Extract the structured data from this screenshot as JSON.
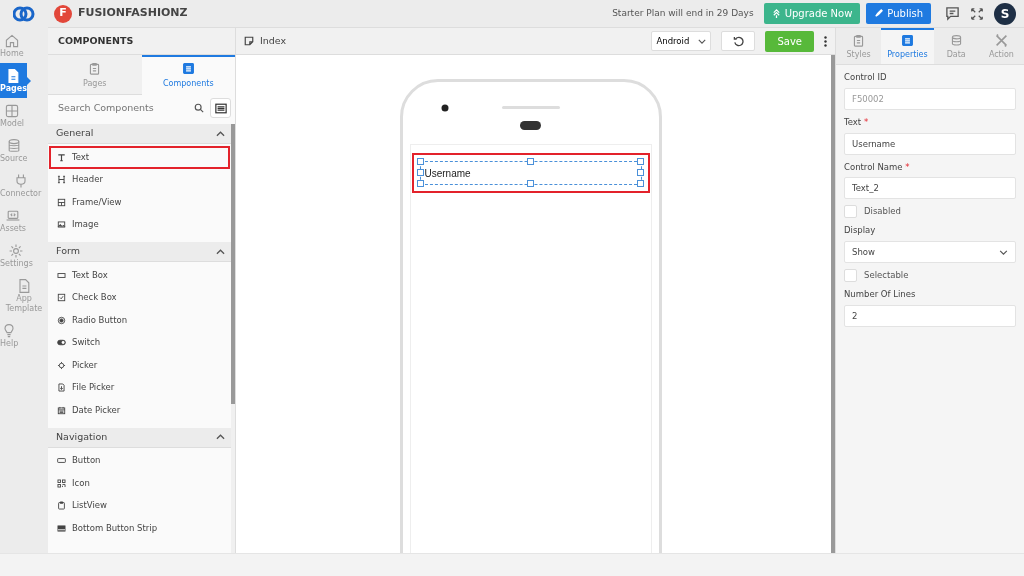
{
  "rail": {
    "items": [
      {
        "label": "Home",
        "selected": false
      },
      {
        "label": "Pages",
        "selected": true
      },
      {
        "label": "Model",
        "selected": false
      },
      {
        "label": "Source",
        "selected": false
      },
      {
        "label": "Connector",
        "selected": false
      },
      {
        "label": "Assets",
        "selected": false
      },
      {
        "label": "Settings",
        "selected": false
      },
      {
        "label": "App Template",
        "selected": false
      },
      {
        "label": "Help",
        "selected": false
      }
    ]
  },
  "header": {
    "logo_letter": "F",
    "app_name": "FUSIONFASHIONZ",
    "plan_notice": "Starter Plan will end in 29 Days",
    "upgrade": "Upgrade Now",
    "publish": "Publish",
    "avatar": "S"
  },
  "components_panel": {
    "title": "COMPONENTS",
    "tabs": [
      {
        "label": "Pages",
        "selected": false
      },
      {
        "label": "Components",
        "selected": true
      }
    ],
    "search": {
      "placeholder": "Search Components"
    },
    "groups": [
      {
        "title": "General",
        "expanded": true,
        "items": [
          {
            "label": "Text",
            "selected": true
          },
          {
            "label": "Header",
            "selected": false
          },
          {
            "label": "Frame/View",
            "selected": false
          },
          {
            "label": "Image",
            "selected": false
          }
        ]
      },
      {
        "title": "Form",
        "expanded": true,
        "items": [
          {
            "label": "Text Box",
            "selected": false
          },
          {
            "label": "Check Box",
            "selected": false
          },
          {
            "label": "Radio Button",
            "selected": false
          },
          {
            "label": "Switch",
            "selected": false
          },
          {
            "label": "Picker",
            "selected": false
          },
          {
            "label": "File Picker",
            "selected": false
          },
          {
            "label": "Date Picker",
            "selected": false
          }
        ]
      },
      {
        "title": "Navigation",
        "expanded": true,
        "items": [
          {
            "label": "Button",
            "selected": false
          },
          {
            "label": "Icon",
            "selected": false
          },
          {
            "label": "ListView",
            "selected": false
          },
          {
            "label": "Bottom Button Strip",
            "selected": false
          }
        ]
      }
    ]
  },
  "canvas": {
    "page_name": "Index",
    "device": "Android",
    "save": "Save",
    "elements": [
      {
        "text": "Username",
        "selected": true
      }
    ]
  },
  "properties_panel": {
    "tabs": [
      {
        "label": "Styles",
        "selected": false
      },
      {
        "label": "Properties",
        "selected": true
      },
      {
        "label": "Data",
        "selected": false
      },
      {
        "label": "Action",
        "selected": false
      }
    ],
    "fields": [
      {
        "kind": "text",
        "label": "Control ID",
        "value": "F50002",
        "disabled": true
      },
      {
        "kind": "text",
        "label": "Text",
        "required_mark": "*",
        "value": "Username",
        "disabled": false
      },
      {
        "kind": "text",
        "label": "Control Name",
        "required_mark": "*",
        "value": "Text_2",
        "disabled": false
      },
      {
        "kind": "checkbox",
        "label": "Disabled",
        "checked": false
      },
      {
        "kind": "select",
        "label": "Display",
        "value": "Show"
      },
      {
        "kind": "checkbox",
        "label": "Selectable",
        "checked": false
      },
      {
        "kind": "text",
        "label": "Number Of Lines",
        "value": "2",
        "disabled": false
      }
    ]
  }
}
